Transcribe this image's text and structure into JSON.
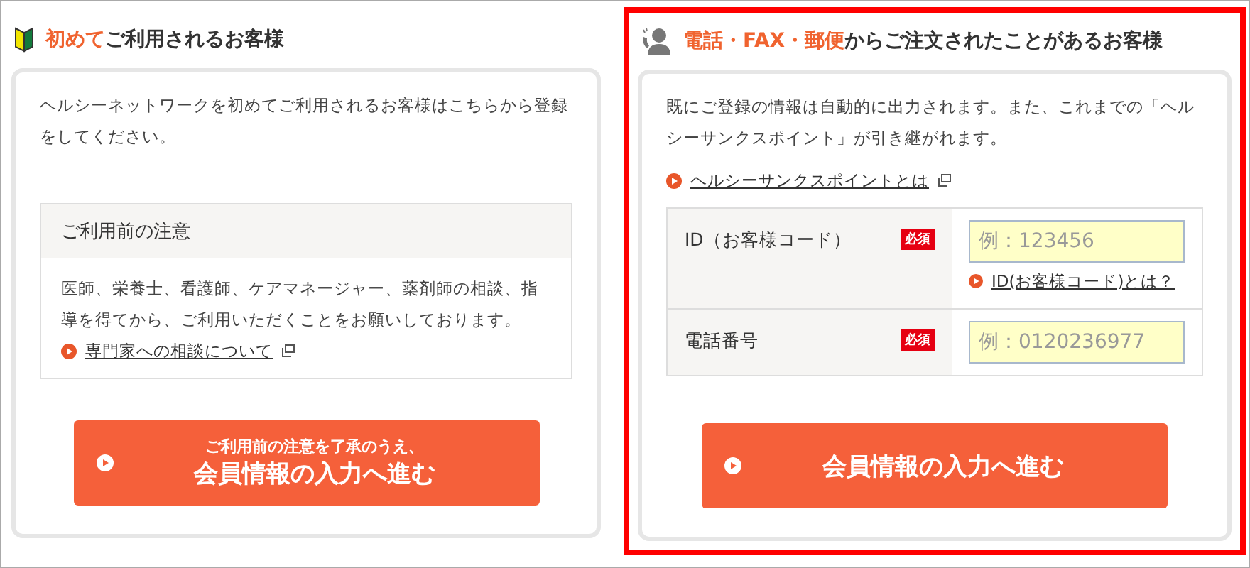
{
  "left": {
    "title": [
      {
        "text": "初めて",
        "accent": true
      },
      {
        "text": "ご利用されるお客様",
        "accent": false
      }
    ],
    "intro": "ヘルシーネットワークを初めてご利用されるお客様はこちらから登録をしてください。",
    "notice": {
      "heading": "ご利用前の注意",
      "body": "医師、栄養士、看護師、ケアマネージャー、薬剤師の相談、指導を得てから、ご利用いただくことをお願いしております。",
      "link": "専門家への相談について"
    },
    "button": {
      "lines": [
        "ご利用前の注意を了承のうえ、",
        "会員情報の入力へ進む"
      ]
    }
  },
  "right": {
    "title": [
      {
        "text": "電話・FAX・郵便",
        "accent": true
      },
      {
        "text": "からご注文されたことがあるお客様",
        "accent": false
      }
    ],
    "highlighted": true,
    "intro": "既にご登録の情報は自動的に出力されます。また、これまでの「ヘルシーサンクスポイント」が引き継がれます。",
    "link": "ヘルシーサンクスポイントとは",
    "form": [
      {
        "label": "ID（お客様コード）",
        "required": "必須",
        "placeholder": "例：123456",
        "help": "ID(お客様コード)とは？"
      },
      {
        "label": "電話番号",
        "required": "必須",
        "placeholder": "例：0120236977"
      }
    ],
    "button": {
      "lines": [
        "会員情報の入力へ進む"
      ]
    }
  }
}
